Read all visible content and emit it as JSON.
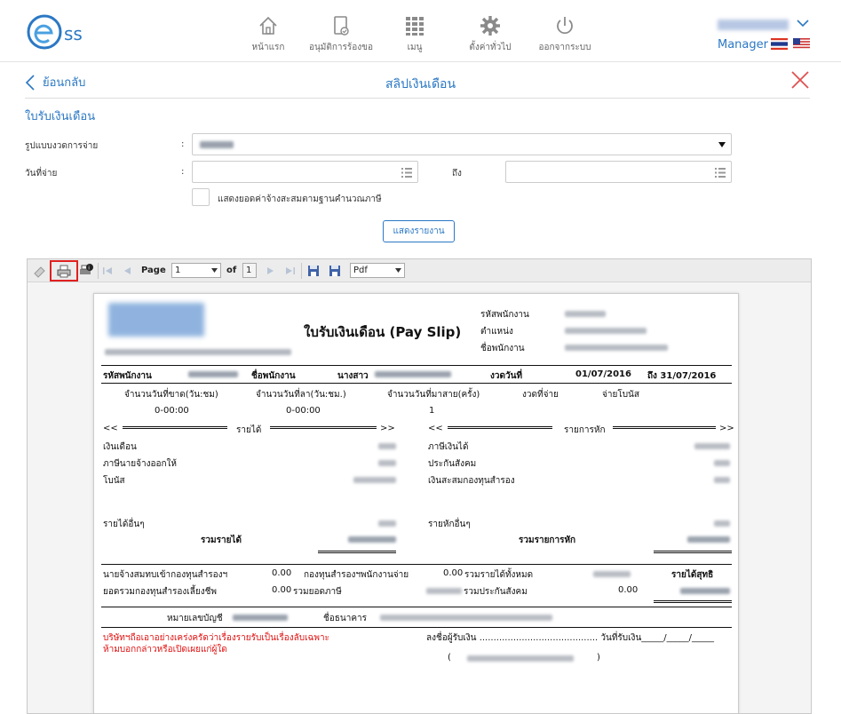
{
  "header": {
    "logo_text": "ss",
    "nav": [
      {
        "label": "หน้าแรก",
        "icon": "home-icon"
      },
      {
        "label": "อนุมัติการร้องขอ",
        "icon": "approve-document-icon"
      },
      {
        "label": "เมนู",
        "icon": "grid-menu-icon"
      },
      {
        "label": "ตั้งค่าทั่วไป",
        "icon": "gear-icon"
      },
      {
        "label": "ออกจากระบบ",
        "icon": "power-icon"
      }
    ],
    "role": "Manager"
  },
  "subheader": {
    "back_label": "ย้อนกลับ",
    "title": "สลิปเงินเดือน"
  },
  "form": {
    "section_title": "ใบรับเงินเดือน",
    "pay_type_label": "รูปแบบงวดการจ่าย",
    "pay_date_label": "วันที่จ่าย",
    "to_label": "ถึง",
    "colon": ":",
    "accumulate_label": "แสดงยอดค่าจ้างสะสมตามฐานคำนวณภาษี",
    "show_button": "แสดงรายงาน"
  },
  "toolbar": {
    "page_label": "Page",
    "page_value": "1",
    "of_label": "of",
    "total_pages": "1",
    "format_value": "Pdf"
  },
  "slip": {
    "title": "ใบรับเงินเดือน (Pay Slip)",
    "hdr_emp_code": "รหัสพนักงาน",
    "hdr_position": "ตำแหน่ง",
    "hdr_emp_name": "ชื่อพนักงาน",
    "row_emp_code": "รหัสพนักงาน",
    "row_emp_name": "ชื่อพนักงาน",
    "row_name_prefix": "นางสาว",
    "row_period": "งวดวันที่",
    "period_from": "01/07/2016",
    "period_to": "ถึง 31/07/2016",
    "col_absent": "จำนวนวันที่ขาด(วัน:ชม)",
    "col_leave": "จำนวนวันที่ลา(วัน:ชม.)",
    "col_late": "จำนวนวันที่มาสาย(ครั้ง)",
    "col_period_pay": "งวดที่จ่าย",
    "col_bonus": "จ่ายโบนัส",
    "val_absent": "0-00:00",
    "val_leave": "0-00:00",
    "val_late": "1",
    "income_header": "รายได้",
    "deduct_header": "รายการหัก",
    "arrow_left": "<<",
    "arrow_right": ">>",
    "income_items": [
      "เงินเดือน",
      "ภาษีนายจ้างออกให้",
      "โบนัส"
    ],
    "deduct_items": [
      "ภาษีเงินได้",
      "ประกันสังคม",
      "เงินสะสมกองทุนสำรอง"
    ],
    "other_income": "รายได้อื่นๆ",
    "other_deduct": "รายหักอื่นๆ",
    "total_income": "รวมรายได้",
    "total_deduct": "รวมรายการหัก",
    "fund_employer": "นายจ้างสมทบเข้ากองทุนสำรองฯ",
    "fund_employer_val": "0.00",
    "fund_employee": "กองทุนสำรองฯพนักงานจ่าย",
    "fund_employee_val": "0.00",
    "total_all_income": "รวมรายได้ทั้งหมด",
    "net_income": "รายได้สุทธิ",
    "fund_total": "ยอดรวมกองทุนสำรองเลี้ยงชีพ",
    "fund_total_val": "0.00",
    "total_tax": "รวมยอดภาษี",
    "total_ss": "รวมประกันสังคม",
    "total_ss_val": "0.00",
    "account_label": "หมายเลขบัญชี",
    "bank_label": "ชื่อธนาคาร",
    "notice_1": "บริษัทฯถือเอาอย่างเคร่งครัดว่าเรื่องรายรับเป็นเรื่องลับเฉพาะ",
    "notice_2": "ห้ามบอกกล่าวหรือเปิดเผยแก่ผู้ใด",
    "sign_line": "ลงชื่อผู้รับเงิน .......................................... วันที่รับเงิน_____/_____/_____",
    "paren_open": "(",
    "paren_close": ")"
  },
  "colors": {
    "accent": "#2b78c4",
    "close": "#e05050",
    "notice": "#e01010"
  }
}
